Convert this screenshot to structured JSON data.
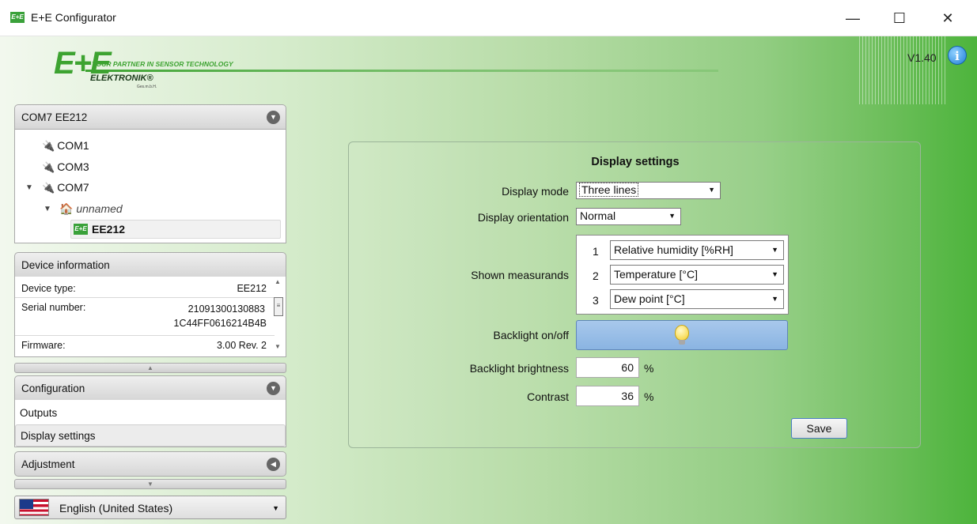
{
  "window": {
    "title": "E+E Configurator",
    "app_icon": "E+E",
    "minimize": "—",
    "maximize": "☐",
    "close": "✕"
  },
  "header": {
    "logo_mark": "E+E",
    "slogan": "YOUR PARTNER IN SENSOR TECHNOLOGY",
    "company": "ELEKTRONIK®",
    "company_suffix": "Ges.m.b.H.",
    "version": "V1.40",
    "info_glyph": "i"
  },
  "connection": {
    "header": "COM7 EE212",
    "tree": {
      "com1": "COM1",
      "com3": "COM3",
      "com7": "COM7",
      "network": "unnamed",
      "device_badge": "E+E",
      "device": "EE212"
    }
  },
  "device_info": {
    "header": "Device information",
    "type_label": "Device type:",
    "type_value": "EE212",
    "serial_label": "Serial number:",
    "serial_value_1": "21091300130883",
    "serial_value_2": "1C44FF0616214B4B",
    "firmware_label": "Firmware:",
    "firmware_value": "3.00 Rev. 2"
  },
  "configuration": {
    "header": "Configuration",
    "items": [
      "Outputs",
      "Display settings"
    ]
  },
  "adjustment": {
    "header": "Adjustment"
  },
  "language": {
    "selected": "English (United States)"
  },
  "display_settings": {
    "title": "Display settings",
    "mode_label": "Display mode",
    "mode_value": "Three lines",
    "orientation_label": "Display orientation",
    "orientation_value": "Normal",
    "measurands_label": "Shown measurands",
    "measurands": [
      {
        "num": "1",
        "value": "Relative humidity [%RH]"
      },
      {
        "num": "2",
        "value": "Temperature [°C]"
      },
      {
        "num": "3",
        "value": "Dew point [°C]"
      }
    ],
    "backlight_label": "Backlight on/off",
    "brightness_label": "Backlight brightness",
    "brightness_value": "60",
    "contrast_label": "Contrast",
    "contrast_value": "36",
    "percent": "%",
    "save_label": "Save"
  }
}
